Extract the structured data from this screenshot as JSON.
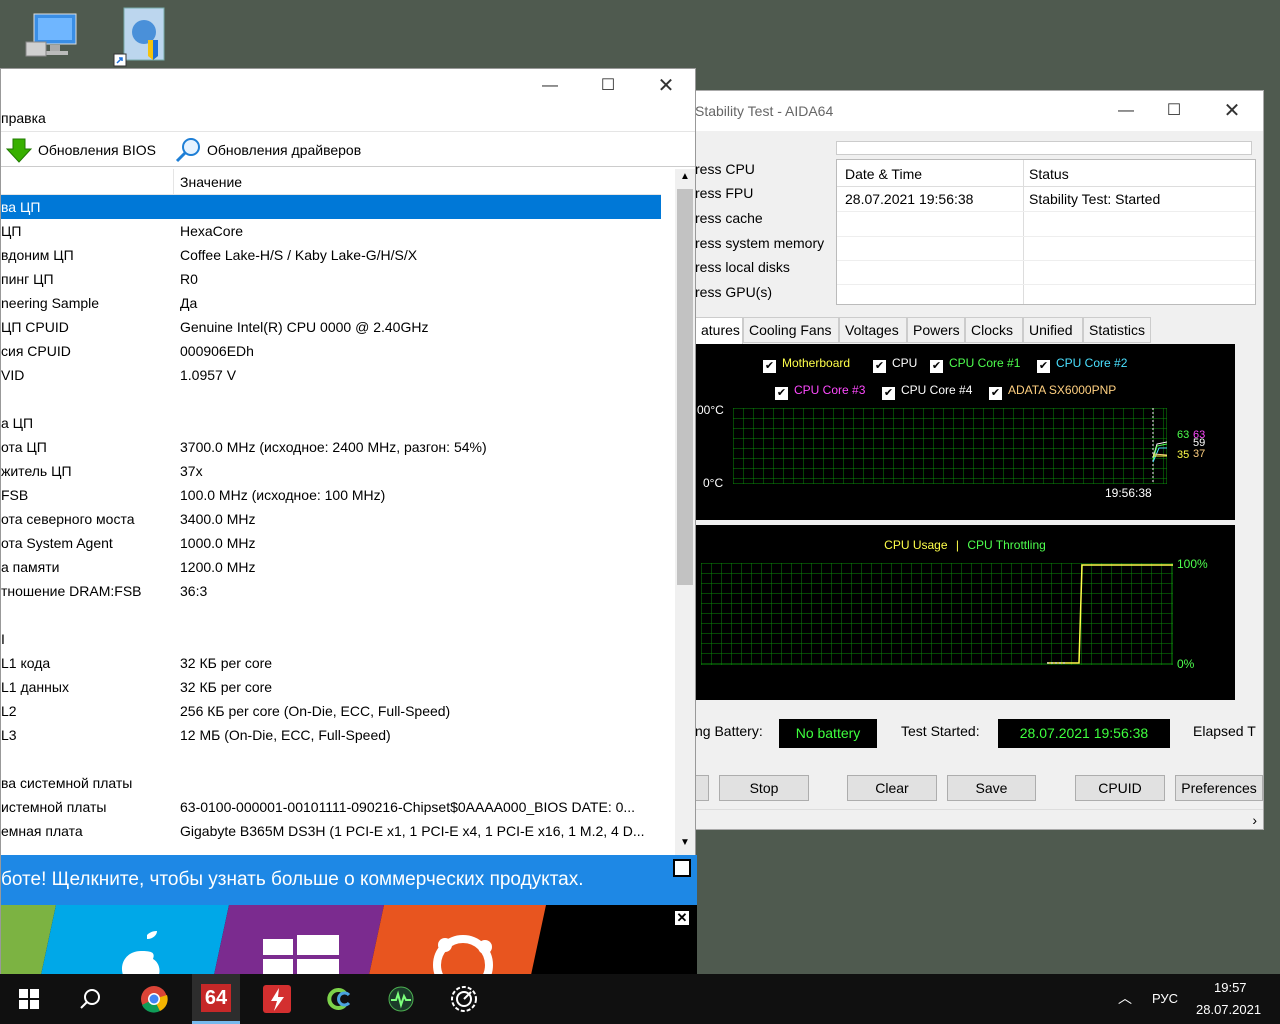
{
  "desktop": {
    "icons": [
      "this-pc-icon",
      "control-panel-shortcut-icon"
    ]
  },
  "stability": {
    "title": "Stability Test - AIDA64",
    "stress_items": [
      "ress CPU",
      "ress FPU",
      "ress cache",
      "ress system memory",
      "ress local disks",
      "ress GPU(s)"
    ],
    "table": {
      "headers": [
        "Date & Time",
        "Status"
      ],
      "rows": [
        [
          "28.07.2021 19:56:38",
          "Stability Test: Started"
        ]
      ]
    },
    "tabs": [
      "atures",
      "Cooling Fans",
      "Voltages",
      "Powers",
      "Clocks",
      "Unified",
      "Statistics"
    ],
    "temp_graph": {
      "legend": [
        {
          "label": "Motherboard",
          "color": "#ffff4a",
          "checked": true
        },
        {
          "label": "CPU",
          "color": "#ffffff",
          "checked": true
        },
        {
          "label": "CPU Core #1",
          "color": "#4eff4e",
          "checked": true
        },
        {
          "label": "CPU Core #2",
          "color": "#4ae0ff",
          "checked": true
        },
        {
          "label": "CPU Core #3",
          "color": "#ff4aff",
          "checked": true
        },
        {
          "label": "CPU Core #4",
          "color": "#ffffff",
          "checked": true
        },
        {
          "label": "ADATA SX6000PNP",
          "color": "#ffd080",
          "checked": true
        }
      ],
      "y_top": "00°C",
      "y_bottom": "0°C",
      "time": "19:56:38",
      "values_top": [
        "63",
        "63",
        "59"
      ],
      "values_bottom": [
        "35",
        "37"
      ]
    },
    "usage_graph": {
      "legend_usage": "CPU Usage",
      "separator": "|",
      "legend_throttle": "CPU Throttling",
      "y_top": "100%",
      "y_bottom": "0%"
    },
    "status": {
      "battery_label": "ng Battery:",
      "battery_value": "No battery",
      "started_label": "Test Started:",
      "started_value": "28.07.2021 19:56:38",
      "elapsed_label": "Elapsed T"
    },
    "buttons": [
      "Stop",
      "Clear",
      "Save",
      "CPUID",
      "Preferences"
    ]
  },
  "main": {
    "menu_item": "правка",
    "toolbar": {
      "bios": "Обновления BIOS",
      "drivers": "Обновления драйверов"
    },
    "column_value": "Значение",
    "rows": [
      [
        "ва ЦП",
        ""
      ],
      [
        "ЦП",
        "HexaCore"
      ],
      [
        "вдоним ЦП",
        "Coffee Lake-H/S / Kaby Lake-G/H/S/X"
      ],
      [
        "пинг ЦП",
        "R0"
      ],
      [
        "neering Sample",
        "Да"
      ],
      [
        " ЦП CPUID",
        "Genuine Intel(R) CPU 0000 @ 2.40GHz"
      ],
      [
        "сия CPUID",
        "000906EDh"
      ],
      [
        "VID",
        "1.0957 V"
      ],
      [
        "",
        ""
      ],
      [
        "а ЦП",
        ""
      ],
      [
        "ота ЦП",
        "3700.0 MHz  (исходное: 2400 MHz, разгон: 54%)"
      ],
      [
        "житель ЦП",
        "37x"
      ],
      [
        "FSB",
        "100.0 MHz  (исходное: 100 MHz)"
      ],
      [
        "ота северного моста",
        "3400.0 MHz"
      ],
      [
        "ота System Agent",
        "1000.0 MHz"
      ],
      [
        "а памяти",
        "1200.0 MHz"
      ],
      [
        "тношение DRAM:FSB",
        "36:3"
      ],
      [
        "",
        ""
      ],
      [
        "I",
        ""
      ],
      [
        "L1 кода",
        "32 КБ per core"
      ],
      [
        "L1 данных",
        "32 КБ per core"
      ],
      [
        "L2",
        "256 КБ per core  (On-Die, ECC, Full-Speed)"
      ],
      [
        "L3",
        "12 МБ  (On-Die, ECC, Full-Speed)"
      ],
      [
        "",
        ""
      ],
      [
        "ва системной платы",
        ""
      ],
      [
        "истемной платы",
        "63-0100-000001-00101111-090216-Chipset$0AAAA000_BIOS DATE: 0..."
      ],
      [
        "емная плата",
        "Gigabyte B365M DS3H  (1 PCI-E x1, 1 PCI-E x4, 1 PCI-E x16, 1 M.2, 4 D..."
      ]
    ],
    "banner": "боте! Щелкните, чтобы узнать больше о коммерческих продуктах."
  },
  "taskbar": {
    "lang": "РУС",
    "time": "19:57",
    "date": "28.07.2021",
    "aida_label": "64"
  }
}
